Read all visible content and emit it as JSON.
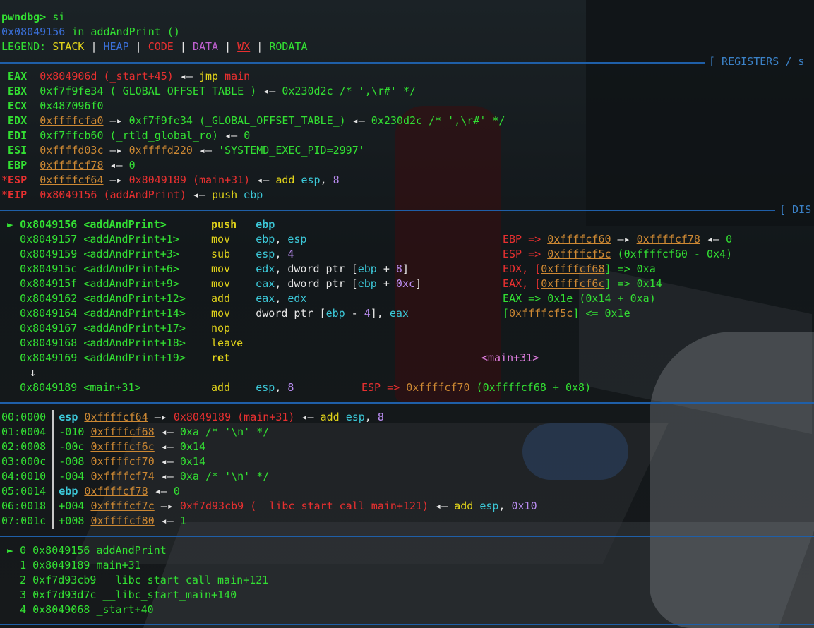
{
  "prompt": {
    "prefix": "pwndbg>",
    "command": "si"
  },
  "location": {
    "addr": "0x08049156",
    "text": "in addAndPrint ()"
  },
  "legend": {
    "label": "LEGEND:",
    "stack": "STACK",
    "heap": "HEAP",
    "code": "CODE",
    "data": "DATA",
    "wx": "WX",
    "rodata": "RODATA",
    "sep": "|"
  },
  "headers": {
    "registers": "[ REGISTERS / s",
    "disasm": "[ DIS"
  },
  "registers": [
    {
      "mark": "",
      "name": "EAX",
      "parts": [
        {
          "t": "0x804906d (_start+45)",
          "c": "r"
        },
        {
          "t": " ◂— ",
          "c": "w"
        },
        {
          "t": "jmp",
          "c": "y"
        },
        {
          "t": " ",
          "c": "w"
        },
        {
          "t": "main",
          "c": "r"
        }
      ]
    },
    {
      "mark": "",
      "name": "EBX",
      "parts": [
        {
          "t": "0xf7f9fe34 (_GLOBAL_OFFSET_TABLE_)",
          "c": "g"
        },
        {
          "t": " ◂— ",
          "c": "w"
        },
        {
          "t": "0x230d2c /* ',\\r#' */",
          "c": "g"
        }
      ]
    },
    {
      "mark": "",
      "name": "ECX",
      "parts": [
        {
          "t": "0x487096f0",
          "c": "g"
        }
      ]
    },
    {
      "mark": "",
      "name": "EDX",
      "parts": [
        {
          "t": "0xffffcfa0",
          "c": "o u"
        },
        {
          "t": " —▸ ",
          "c": "w"
        },
        {
          "t": "0xf7f9fe34 (_GLOBAL_OFFSET_TABLE_)",
          "c": "g"
        },
        {
          "t": " ◂— ",
          "c": "w"
        },
        {
          "t": "0x230d2c /* ',\\r#' */",
          "c": "g"
        }
      ]
    },
    {
      "mark": "",
      "name": "EDI",
      "parts": [
        {
          "t": "0xf7ffcb60 (_rtld_global_ro)",
          "c": "g"
        },
        {
          "t": " ◂— ",
          "c": "w"
        },
        {
          "t": "0",
          "c": "g"
        }
      ]
    },
    {
      "mark": "",
      "name": "ESI",
      "parts": [
        {
          "t": "0xffffd03c",
          "c": "o u"
        },
        {
          "t": " —▸ ",
          "c": "w"
        },
        {
          "t": "0xffffd220",
          "c": "o u"
        },
        {
          "t": " ◂— ",
          "c": "w"
        },
        {
          "t": "'SYSTEMD_EXEC_PID=2997'",
          "c": "g"
        }
      ]
    },
    {
      "mark": "",
      "name": "EBP",
      "parts": [
        {
          "t": "0xffffcf78",
          "c": "o u"
        },
        {
          "t": " ◂— ",
          "c": "w"
        },
        {
          "t": "0",
          "c": "g"
        }
      ]
    },
    {
      "mark": "*",
      "name": "ESP",
      "parts": [
        {
          "t": "0xffffcf64",
          "c": "o u"
        },
        {
          "t": " —▸ ",
          "c": "w"
        },
        {
          "t": "0x8049189 (main+31)",
          "c": "r"
        },
        {
          "t": " ◂— ",
          "c": "w"
        },
        {
          "t": "add",
          "c": "y"
        },
        {
          "t": " ",
          "c": "w"
        },
        {
          "t": "esp",
          "c": "cy"
        },
        {
          "t": ", ",
          "c": "w"
        },
        {
          "t": "8",
          "c": "n"
        }
      ]
    },
    {
      "mark": "*",
      "name": "EIP",
      "parts": [
        {
          "t": "0x8049156 (addAndPrint)",
          "c": "r"
        },
        {
          "t": " ◂— ",
          "c": "w"
        },
        {
          "t": "push",
          "c": "y"
        },
        {
          "t": " ",
          "c": "w"
        },
        {
          "t": "ebp",
          "c": "cy"
        }
      ]
    }
  ],
  "disasm": [
    {
      "arrow": "►",
      "addr": "0x8049156",
      "sym": "<addAndPrint>",
      "mn": "push",
      "ops": [
        {
          "t": "ebp",
          "c": "cy"
        }
      ],
      "cur": true,
      "note": []
    },
    {
      "arrow": "",
      "addr": "0x8049157",
      "sym": "<addAndPrint+1>",
      "mn": "mov",
      "ops": [
        {
          "t": "ebp",
          "c": "cy"
        },
        {
          "t": ", ",
          "c": "w"
        },
        {
          "t": "esp",
          "c": "cy"
        }
      ],
      "note": [
        {
          "t": "EBP => ",
          "c": "r"
        },
        {
          "t": "0xffffcf60",
          "c": "o u"
        },
        {
          "t": " —▸ ",
          "c": "w"
        },
        {
          "t": "0xffffcf78",
          "c": "o u"
        },
        {
          "t": " ◂— ",
          "c": "w"
        },
        {
          "t": "0",
          "c": "g"
        }
      ]
    },
    {
      "arrow": "",
      "addr": "0x8049159",
      "sym": "<addAndPrint+3>",
      "mn": "sub",
      "ops": [
        {
          "t": "esp",
          "c": "cy"
        },
        {
          "t": ", ",
          "c": "w"
        },
        {
          "t": "4",
          "c": "n"
        }
      ],
      "note": [
        {
          "t": "ESP => ",
          "c": "r"
        },
        {
          "t": "0xffffcf5c",
          "c": "o u"
        },
        {
          "t": " (0xffffcf60 - 0x4)",
          "c": "g"
        }
      ]
    },
    {
      "arrow": "",
      "addr": "0x804915c",
      "sym": "<addAndPrint+6>",
      "mn": "mov",
      "ops": [
        {
          "t": "edx",
          "c": "cy"
        },
        {
          "t": ", dword ptr [",
          "c": "w"
        },
        {
          "t": "ebp",
          "c": "cy"
        },
        {
          "t": " + ",
          "c": "w"
        },
        {
          "t": "8",
          "c": "n"
        },
        {
          "t": "]",
          "c": "w"
        }
      ],
      "note": [
        {
          "t": "EDX, [",
          "c": "r"
        },
        {
          "t": "0xffffcf68",
          "c": "o u"
        },
        {
          "t": "] => 0xa",
          "c": "g"
        }
      ]
    },
    {
      "arrow": "",
      "addr": "0x804915f",
      "sym": "<addAndPrint+9>",
      "mn": "mov",
      "ops": [
        {
          "t": "eax",
          "c": "cy"
        },
        {
          "t": ", dword ptr [",
          "c": "w"
        },
        {
          "t": "ebp",
          "c": "cy"
        },
        {
          "t": " + ",
          "c": "w"
        },
        {
          "t": "0xc",
          "c": "n"
        },
        {
          "t": "]",
          "c": "w"
        }
      ],
      "note": [
        {
          "t": "EAX, [",
          "c": "r"
        },
        {
          "t": "0xffffcf6c",
          "c": "o u"
        },
        {
          "t": "] => 0x14",
          "c": "g"
        }
      ]
    },
    {
      "arrow": "",
      "addr": "0x8049162",
      "sym": "<addAndPrint+12>",
      "mn": "add",
      "ops": [
        {
          "t": "eax",
          "c": "cy"
        },
        {
          "t": ", ",
          "c": "w"
        },
        {
          "t": "edx",
          "c": "cy"
        }
      ],
      "note": [
        {
          "t": "EAX => 0x1e (0x14 + 0xa)",
          "c": "g"
        }
      ]
    },
    {
      "arrow": "",
      "addr": "0x8049164",
      "sym": "<addAndPrint+14>",
      "mn": "mov",
      "ops": [
        {
          "t": "dword ptr [",
          "c": "w"
        },
        {
          "t": "ebp",
          "c": "cy"
        },
        {
          "t": " - ",
          "c": "w"
        },
        {
          "t": "4",
          "c": "n"
        },
        {
          "t": "], ",
          "c": "w"
        },
        {
          "t": "eax",
          "c": "cy"
        }
      ],
      "note": [
        {
          "t": "[",
          "c": "g"
        },
        {
          "t": "0xffffcf5c",
          "c": "o u"
        },
        {
          "t": "] <= 0x1e",
          "c": "g"
        }
      ]
    },
    {
      "arrow": "",
      "addr": "0x8049167",
      "sym": "<addAndPrint+17>",
      "mn": "nop",
      "ops": [],
      "note": []
    },
    {
      "arrow": "",
      "addr": "0x8049168",
      "sym": "<addAndPrint+18>",
      "mn": "leave",
      "ops": [],
      "note": []
    },
    {
      "arrow": "",
      "addr": "0x8049169",
      "sym": "<addAndPrint+19>",
      "mn": "ret",
      "ops": [],
      "bold": true,
      "note": [
        {
          "t": "<main+31>",
          "c": "mg"
        }
      ]
    }
  ],
  "disasm_down": "↓",
  "disasm_next": {
    "addr": "0x8049189",
    "sym": "<main+31>",
    "mn": "add",
    "ops": [
      {
        "t": "esp",
        "c": "cy"
      },
      {
        "t": ", ",
        "c": "w"
      },
      {
        "t": "8",
        "c": "n"
      }
    ],
    "note": [
      {
        "t": "ESP => ",
        "c": "r"
      },
      {
        "t": "0xffffcf70",
        "c": "o u"
      },
      {
        "t": " (0xffffcf68 + 0x8)",
        "c": "g"
      }
    ]
  },
  "stack": [
    {
      "idx": "00:0000",
      "off": "esp",
      "offc": "cy bold",
      "addr": "0xffffcf64",
      "rest": [
        {
          "t": " —▸ ",
          "c": "w"
        },
        {
          "t": "0x8049189 (main+31)",
          "c": "r"
        },
        {
          "t": " ◂— ",
          "c": "w"
        },
        {
          "t": "add",
          "c": "y"
        },
        {
          "t": " ",
          "c": "w"
        },
        {
          "t": "esp",
          "c": "cy"
        },
        {
          "t": ", ",
          "c": "w"
        },
        {
          "t": "8",
          "c": "n"
        }
      ]
    },
    {
      "idx": "01:0004",
      "off": "-010",
      "offc": "g",
      "addr": "0xffffcf68",
      "rest": [
        {
          "t": " ◂— ",
          "c": "w"
        },
        {
          "t": "0xa /* '\\n' */",
          "c": "g"
        }
      ]
    },
    {
      "idx": "02:0008",
      "off": "-00c",
      "offc": "g",
      "addr": "0xffffcf6c",
      "rest": [
        {
          "t": " ◂— ",
          "c": "w"
        },
        {
          "t": "0x14",
          "c": "g"
        }
      ]
    },
    {
      "idx": "03:000c",
      "off": "-008",
      "offc": "g",
      "addr": "0xffffcf70",
      "rest": [
        {
          "t": " ◂— ",
          "c": "w"
        },
        {
          "t": "0x14",
          "c": "g"
        }
      ]
    },
    {
      "idx": "04:0010",
      "off": "-004",
      "offc": "g",
      "addr": "0xffffcf74",
      "rest": [
        {
          "t": " ◂— ",
          "c": "w"
        },
        {
          "t": "0xa /* '\\n' */",
          "c": "g"
        }
      ]
    },
    {
      "idx": "05:0014",
      "off": "ebp",
      "offc": "cy bold",
      "addr": "0xffffcf78",
      "rest": [
        {
          "t": " ◂— ",
          "c": "w"
        },
        {
          "t": "0",
          "c": "g"
        }
      ]
    },
    {
      "idx": "06:0018",
      "off": "+004",
      "offc": "g",
      "addr": "0xffffcf7c",
      "rest": [
        {
          "t": " —▸ ",
          "c": "w"
        },
        {
          "t": "0xf7d93cb9 (__libc_start_call_main+121)",
          "c": "r"
        },
        {
          "t": " ◂— ",
          "c": "w"
        },
        {
          "t": "add",
          "c": "y"
        },
        {
          "t": " ",
          "c": "w"
        },
        {
          "t": "esp",
          "c": "cy"
        },
        {
          "t": ", ",
          "c": "w"
        },
        {
          "t": "0x10",
          "c": "n"
        }
      ]
    },
    {
      "idx": "07:001c",
      "off": "+008",
      "offc": "g",
      "addr": "0xffffcf80",
      "rest": [
        {
          "t": " ◂— ",
          "c": "w"
        },
        {
          "t": "1",
          "c": "g"
        }
      ]
    }
  ],
  "backtrace": [
    {
      "arrow": "►",
      "n": "0",
      "addr": "0x8049156",
      "fn": "addAndPrint"
    },
    {
      "arrow": "",
      "n": "1",
      "addr": "0x8049189",
      "fn": "main+31"
    },
    {
      "arrow": "",
      "n": "2",
      "addr": "0xf7d93cb9",
      "fn": "__libc_start_call_main+121"
    },
    {
      "arrow": "",
      "n": "3",
      "addr": "0xf7d93d7c",
      "fn": "__libc_start_main+140"
    },
    {
      "arrow": "",
      "n": "4",
      "addr": "0x8049068",
      "fn": "_start+40"
    }
  ],
  "colors": {
    "separator": "#1f5fa8",
    "green": "#33e033",
    "red": "#e83030",
    "yellow": "#e0d21a",
    "cyan": "#3cc8d8",
    "orange": "#cc8833",
    "purple": "#b98cf0"
  }
}
